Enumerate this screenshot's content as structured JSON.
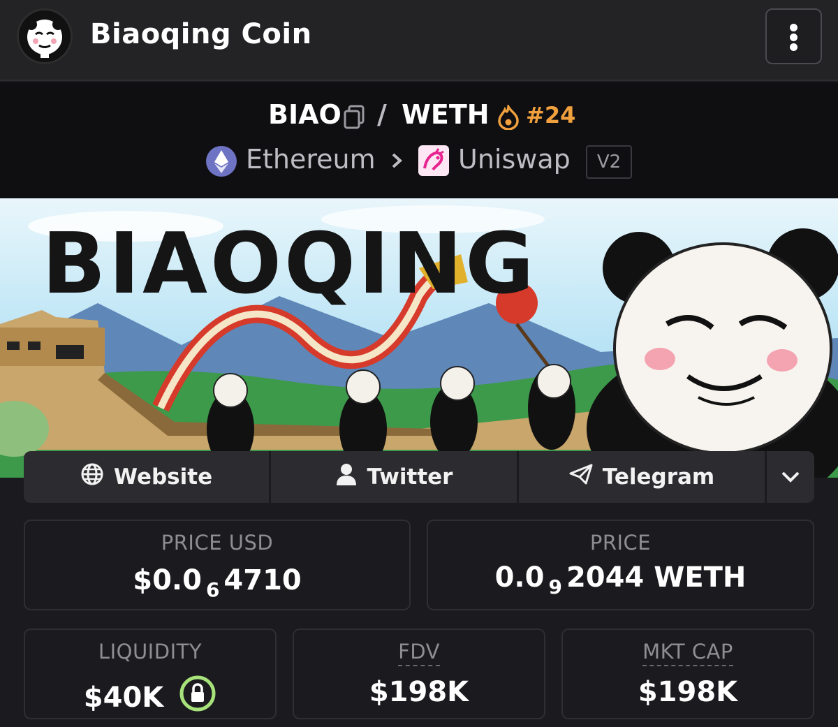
{
  "header": {
    "title": "Biaoqing Coin",
    "logo_text": "BIAOQING"
  },
  "pair": {
    "base": "BIAO",
    "separator": "/",
    "quote": "WETH",
    "rank": "#24",
    "chain": "Ethereum",
    "dex": "Uniswap",
    "version": "V2"
  },
  "banner": {
    "title_text": "BIAOQING"
  },
  "links": [
    {
      "label": "Website",
      "icon": "globe-icon"
    },
    {
      "label": "Twitter",
      "icon": "user-icon"
    },
    {
      "label": "Telegram",
      "icon": "telegram-icon"
    }
  ],
  "stats": {
    "price_usd": {
      "label": "PRICE USD",
      "prefix": "$0.0",
      "sub": "6",
      "suffix": "4710"
    },
    "price": {
      "label": "PRICE",
      "prefix": "0.0",
      "sub": "9",
      "suffix": "2044 WETH"
    },
    "liquidity": {
      "label": "LIQUIDITY",
      "value": "$40K"
    },
    "fdv": {
      "label": "FDV",
      "value": "$198K"
    },
    "mkt_cap": {
      "label": "MKT CAP",
      "value": "$198K"
    }
  },
  "colors": {
    "rank": "#f0a13d",
    "lock_ring": "#a7e37a",
    "background": "#1b1b1f"
  }
}
